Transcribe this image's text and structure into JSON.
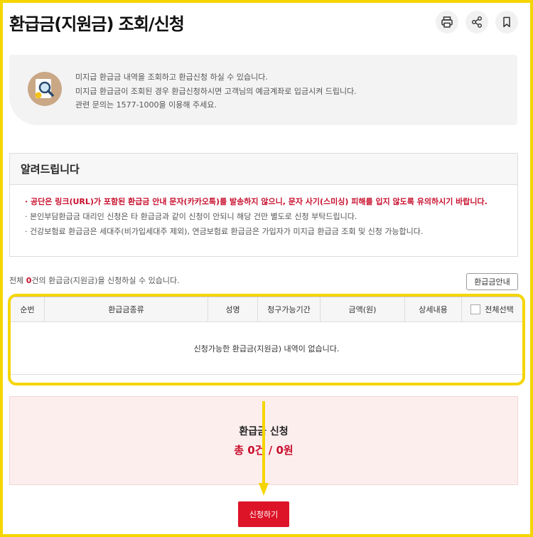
{
  "header": {
    "title": "환급금(지원금) 조회/신청",
    "icons": [
      "print-icon",
      "share-icon",
      "bookmark-icon"
    ]
  },
  "info": {
    "lines": [
      "미지급 환급금 내역을 조회하고 환급신청 하실 수 있습니다.",
      "미지급 환급금이 조회된 경우 환급신청하시면 고객님의 예금계좌로 입금시켜 드립니다.",
      "관련 문의는 1577-1000을 이용해 주세요."
    ]
  },
  "notice": {
    "title": "알려드립니다",
    "items": [
      "공단은 링크(URL)가 포함된 환급금 안내 문자(카카오톡)를 발송하지 않으니, 문자 사기(스미싱) 피해를 입지 않도록 유의하시기 바랍니다.",
      "본인부담환급금 대리인 신청은 타 환급금과 같이 신청이 안되니 해당 건만 별도로 신청 부탁드립니다.",
      "건강보험료 환급금은 세대주(비가입세대주 제외), 연금보험료 환급금은 가입자가 미지급 환급금 조회 및 신청 가능합니다."
    ]
  },
  "count": {
    "prefix": "전체 ",
    "value": "0",
    "suffix": "건의 환급금(지원금)을 신청하실 수 있습니다."
  },
  "guide_button": "환급금안내",
  "table": {
    "headers": [
      "순번",
      "환급금종류",
      "성명",
      "청구가능기간",
      "금액(원)",
      "상세내용",
      "전체선택"
    ],
    "empty_message": "신청가능한 환급금(지원금) 내역이 없습니다."
  },
  "summary": {
    "title": "환급금 신청",
    "total": "총 0건 / 0원"
  },
  "apply_button": "신청하기",
  "colors": {
    "highlight": "#f5d500",
    "accent": "#c8102e",
    "button": "#dd1428"
  }
}
